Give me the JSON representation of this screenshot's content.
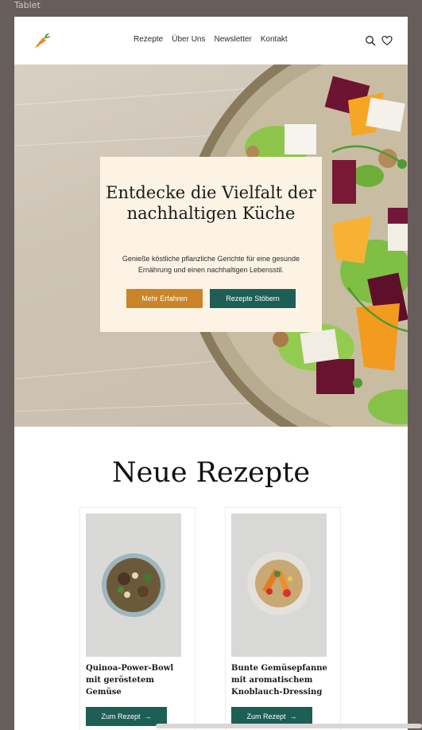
{
  "frame": {
    "label": "Tablet"
  },
  "header": {
    "logo_icon": "carrot-icon",
    "nav": [
      "Rezepte",
      "Über Uns",
      "Newsletter",
      "Kontakt"
    ],
    "icons": [
      "search-icon",
      "heart-icon"
    ]
  },
  "hero": {
    "title": "Entdecke die Vielfalt der nachhaltigen Küche",
    "text": "Genieße köstliche pflanzliche Gerichte für eine gesunde Ernährung und einen nachhaltigen Lebensstil.",
    "primary_button": "Mehr Erfahren",
    "secondary_button": "Rezepte Stöbern",
    "colors": {
      "primary": "#c98527",
      "secondary": "#1d5f55",
      "card": "#fdf3e5"
    }
  },
  "recipes": {
    "title": "Neue Rezepte",
    "cards": [
      {
        "title": "Quinoa-Power-Bowl mit geröstetem Gemüse",
        "button": "Zum Rezept"
      },
      {
        "title": "Bunte Gemüsepfanne mit aromatischem Knoblauch-Dressing",
        "button": "Zum Rezept"
      }
    ]
  }
}
